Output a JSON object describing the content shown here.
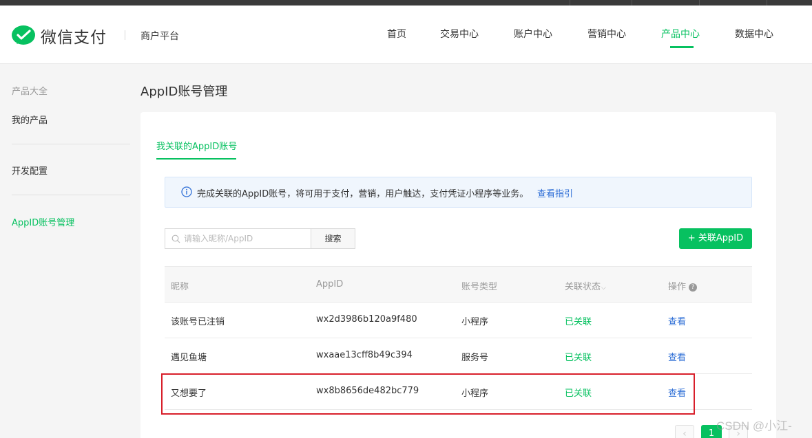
{
  "header": {
    "brand": "微信支付",
    "platform": "商户平台",
    "nav": [
      {
        "label": "首页"
      },
      {
        "label": "交易中心"
      },
      {
        "label": "账户中心"
      },
      {
        "label": "营销中心"
      },
      {
        "label": "产品中心",
        "active": true
      },
      {
        "label": "数据中心"
      }
    ]
  },
  "sidebar": {
    "group_title": "产品大全",
    "items": [
      {
        "label": "我的产品"
      },
      {
        "label": "开发配置"
      },
      {
        "label": "AppID账号管理",
        "active": true
      }
    ]
  },
  "page": {
    "title": "AppID账号管理",
    "tab": "我关联的AppID账号"
  },
  "notice": {
    "icon": "info-icon",
    "text": "完成关联的AppID账号，将可用于支付，营销，用户触达，支付凭证小程序等业务。",
    "link": "查看指引"
  },
  "search": {
    "placeholder": "请输入昵称/AppID",
    "value": "",
    "button": "搜索"
  },
  "add_button": "+ 关联AppID",
  "table": {
    "columns": [
      "昵称",
      "AppID",
      "账号类型",
      "关联状态",
      "操作"
    ],
    "rows": [
      {
        "nickname": "该账号已注销",
        "appid": "wx2d3986b120a9f480",
        "type": "小程序",
        "status": "已关联",
        "action": "查看"
      },
      {
        "nickname": "遇见鱼塘",
        "appid": "wxaae13cff8b49c394",
        "type": "服务号",
        "status": "已关联",
        "action": "查看"
      },
      {
        "nickname": "又想要了",
        "appid": "wx8b8656de482bc779",
        "type": "小程序",
        "status": "已关联",
        "action": "查看"
      }
    ]
  },
  "pagination": {
    "prev": "‹",
    "current": "1",
    "next": "›"
  },
  "watermark": "CSDN @小江-",
  "colors": {
    "accent": "#07c160",
    "link": "#2f6fd6",
    "highlight": "#d81e2a"
  }
}
